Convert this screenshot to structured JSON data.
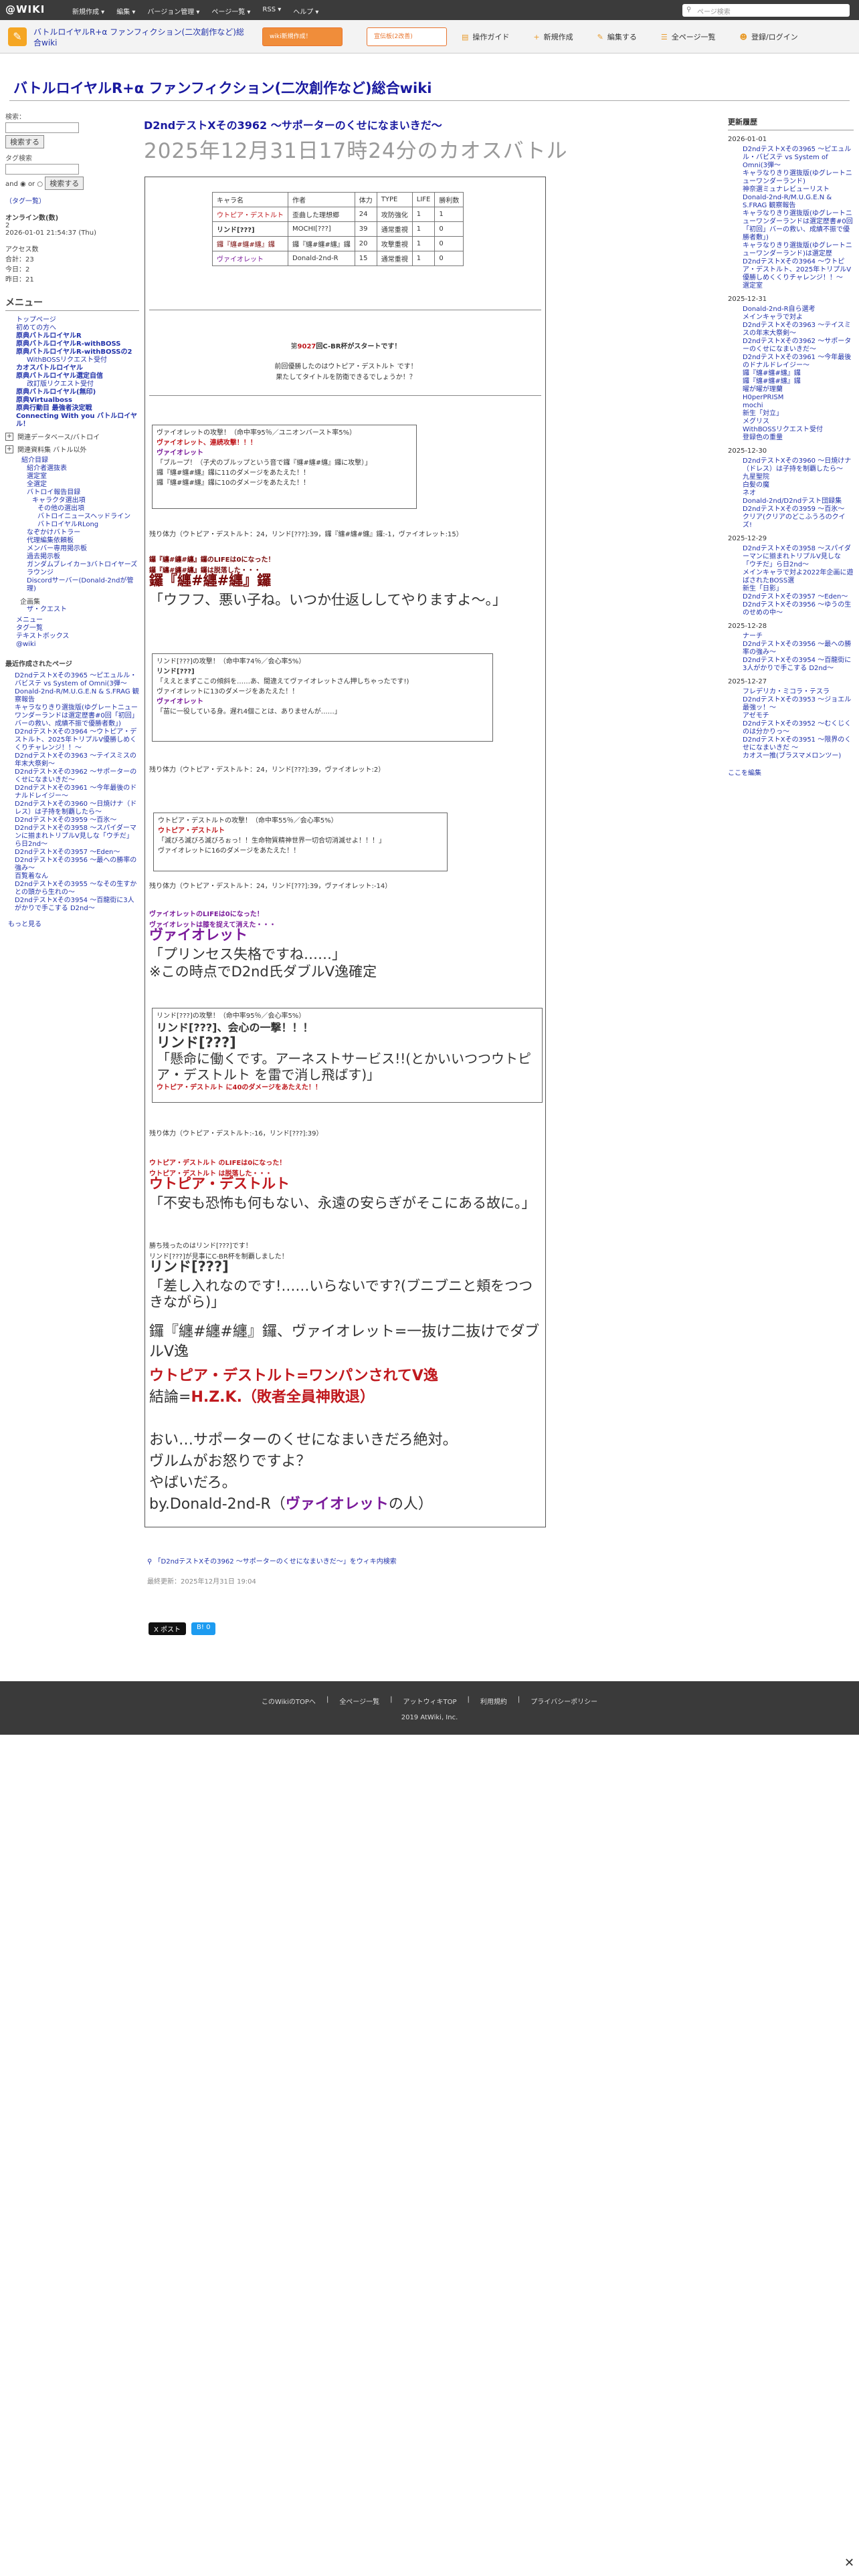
{
  "topbar": {
    "logo": "@WIKI",
    "menus": [
      "新規作成 ▾",
      "編集 ▾",
      "バージョン管理 ▾",
      "ページ一覧 ▾",
      "RSS ▾",
      "ヘルプ ▾"
    ],
    "search_placeholder": "ページ検索"
  },
  "subbar": {
    "site_name": "バトルロイヤルR+α ファンフィクション(二次創作など)総合wiki",
    "btn1": "wiki新規作成！",
    "btn2": "宣伝板(2改善)",
    "tools": [
      "操作ガイド",
      "新規作成",
      "編集する",
      "全ページ一覧",
      "登録/ログイン"
    ]
  },
  "site_title": "バトルロイヤルR+α ファンフィクション(二次創作など)総合wiki",
  "left": {
    "search_label": "検索：",
    "search_btn": "検索する",
    "sub_label": "タグ検索",
    "radio_and": "and",
    "radio_or": "or",
    "search_btn2": "検索する",
    "tag_list": "（タグ一覧）",
    "online_label": "オンライン数(数)",
    "online_count": "2",
    "online_time": "2026-01-01 21:54:37 (Thu)",
    "access_label": "アクセス数",
    "total": "合計：23",
    "today": "今日：2",
    "yesterday": "昨日：21",
    "menu_title": "メニュー",
    "menu_items": [
      {
        "t": "トップページ",
        "c": ""
      },
      {
        "t": "初めての方へ",
        "c": ""
      },
      {
        "t": "原典バトルロイヤルR",
        "c": "b"
      },
      {
        "t": "原典バトルロイヤルR-withBOSS",
        "c": "b"
      },
      {
        "t": "原典バトルロイヤルR-withBOSSの2",
        "c": "b"
      },
      {
        "t": "WithBOSSリクエスト受付",
        "c": "i2"
      },
      {
        "t": "カオスバトルロイヤル",
        "c": "b"
      },
      {
        "t": "原典バトルロイヤル選定自信",
        "c": "b"
      },
      {
        "t": "改訂版リクエスト受付",
        "c": "i2"
      },
      {
        "t": "原典バトルロイヤル(無印)",
        "c": "b"
      },
      {
        "t": "原典Virtualboss",
        "c": "b"
      },
      {
        "t": "原典行動目 最強者決定戦",
        "c": "b"
      },
      {
        "t": "Connecting With you バトルロイヤル！",
        "c": "b"
      }
    ],
    "rel_label1": "関連データベース/バトロイ",
    "rel_label2": "関連資料集 バトル以外",
    "sub_items": [
      {
        "t": "紹介目録",
        "c": "i1"
      },
      {
        "t": "紹介者選抜表",
        "c": "i2"
      },
      {
        "t": "選定室",
        "c": "i2"
      },
      {
        "t": "全選定",
        "c": "i2"
      },
      {
        "t": "バトロイ報告目録",
        "c": "i2"
      },
      {
        "t": "キャラクタ選出項",
        "c": "i3"
      },
      {
        "t": "その他の選出項",
        "c": "i4"
      },
      {
        "t": "バトロイニュースヘッドライン",
        "c": "i4"
      },
      {
        "t": "バトロイヤルRLong",
        "c": "i4"
      },
      {
        "t": "なぞかけバトラー",
        "c": "i2"
      },
      {
        "t": "代理編集依頼板",
        "c": "i2"
      },
      {
        "t": "メンバー専用掲示板",
        "c": "i2"
      },
      {
        "t": "過去掲示板",
        "c": "i2"
      },
      {
        "t": "ガンダムブレイカー3バトロイヤーズラウンジ",
        "c": "i2"
      },
      {
        "t": "Discordサーバー(Donald-2ndが管理)",
        "c": "i2"
      }
    ],
    "plus_label": "企画集",
    "plus_items": [
      "ザ・クエスト"
    ],
    "misc_items": [
      "メニュー",
      "タグ一覧",
      "テキストボックス",
      "@wiki"
    ],
    "recent_title": "最近作成されたページ",
    "recent_items": [
      "D2ndテストXその3965 〜ピエュルル・バビステ vs System of Omni(3弾〜",
      "Donald-2nd-R/M.U.G.E.N & S.FRAG 観察報告",
      "キャラなりきり選抜版(ゆグレートニューワンダーランドは選定歴書#0回「初回」バーの救い、成績不振で優勝者敷」)",
      "D2ndテストXその3964 〜ウトピア・デストルト、2025年トリプルV優勝しめくくりチャレンジ！！〜",
      "D2ndテストXその3963 〜テイスミスの年末大祭剣〜",
      "D2ndテストXその3962 〜サポーターのくせになまいきだ〜",
      "D2ndテストXその3961 〜今年最後のドナルドレイジー〜",
      "D2ndテストXその3960 〜日焼けナ（ドレス）は子持を制覇したら〜",
      "D2ndテストXその3959 〜百氷〜",
      "D2ndテストXその3958 〜スパイダーマンに揃まれトリプルV見しな「ウチだ」ら日2nd〜",
      "D2ndテストXその3957 〜Eden〜",
      "D2ndテストXその3956 〜最への勝率の強み〜",
      "百覧着なん",
      "D2ndテストXその3955 〜なその生すかとの頭から生れの〜",
      "D2ndテストXその3954 〜百龍街に3人がかりで手こする D2nd〜"
    ],
    "more": "もっと見る"
  },
  "main": {
    "subtitle": "D2ndテストXその3962 〜サポーターのくせになまいきだ〜",
    "title": "2025年12月31日17時24分のカオスバトル",
    "table_headers": [
      "キャラ名",
      "作者",
      "体力",
      "TYPE",
      "LIFE",
      "勝利数"
    ],
    "table_rows": [
      [
        "ウトピア・デストルト",
        "歪曲した理想郷",
        "24",
        "攻防強化",
        "1",
        "1"
      ],
      [
        "リンド[???]",
        "MOCHI[???]",
        "39",
        "通常重視",
        "1",
        "0"
      ],
      [
        "鑼『纏#纏#纏』鑼",
        "鑼『纏#纏#纏』鑼",
        "20",
        "攻撃重視",
        "1",
        "0"
      ],
      [
        "ヴァイオレット",
        "Donald-2nd-R",
        "15",
        "通常重視",
        "1",
        "0"
      ]
    ],
    "intro1_pre": "第",
    "intro1_num": "9027",
    "intro1_post": "回C-BR杯がスタートです！",
    "intro2": "前回優勝したのはウトピア・デストルト です！",
    "intro3": "果たしてタイトルを防衛できるでしょうか！？",
    "log1_l1": "ヴァイオレットの攻撃！（命中率95％／ユニオンバースト率5%）",
    "log1_l2": "ヴァイオレット、連続攻撃！！！",
    "log1_l3": "ヴァイオレット",
    "log1_l4": "「ブループ！（子犬のブルップという音で鑼『纏#纏#纏』鑼に攻撃）」",
    "log1_l5": "鑼『纏#纏#纏』鑼に11のダメージをあたえた！！",
    "log1_l6": "鑼『纏#纏#纏』鑼に10のダメージをあたえた！！",
    "remain1": "残り体力（ウトピア・デストルト：24，リンド[???]:39，鑼『纏#纏#纏』鑼:-1，ヴァイオレット:15）",
    "dead1": "鑼『纏#纏#纏』鑼のLIFEは0になった！",
    "dead2": "鑼『纏#纏#纏』鑼は脱落した・・・",
    "big_name1": "鑼『纏#纏#纏』鑼",
    "big_line1": "「ウフフ、悪い子ね。いつか仕返ししてやりますよ〜。」",
    "log2_l1": "リンド[???]の攻撃！（命中率74％／会心率5%）",
    "log2_l2": "リンド[???]",
    "log2_l3": "「ええとまずここの傾斜を……あ、間違えてヴァイオレットさん押しちゃったです!)",
    "log2_l4": "ヴァイオレットに13のダメージをあたえた！！",
    "log2_l5": "ヴァイオレット",
    "log2_l6": "「苗に一役している身。遅れ4個ことは、ありませんが……」",
    "remain2": "残り体力（ウトピア・デストルト：24，リンド[???]:39，ヴァイオレット:2）",
    "log3_l1": "ウトピア・デストルトの攻撃！（命中率55％／会心率5%）",
    "log3_l2": "ウトピア・デストルト",
    "log3_l3": "「滅びろ滅びろ滅びろぉっ！！生命物質精神世界一切合切消滅せよ！！！」",
    "log3_l4": "ヴァイオレットに16のダメージをあたえた！！",
    "remain3": "残り体力（ウトピア・デストルト：24，リンド[???]:39，ヴァイオレット:-14）",
    "dead3": "ヴァイオレットのLIFEは0になった！",
    "dead4": "ヴァイオレットは膝を捉えて消えた・・・",
    "big_name2": "ヴァイオレット",
    "big_line2": "「プリンセス失格ですね……」",
    "big_line3": "※この時点でD2nd氏ダブルV逸確定",
    "log4_l1": "リンド[???]の攻撃！（命中率95％／会心率5%）",
    "log4_l2": "リンド[???]、会心の一撃！！！",
    "log4_l3": "リンド[???]",
    "log4_l4": "「懸命に働くです。アーネストサービス!!(とかいいつつウトピア・デストルト を雷で消し飛ばす)」",
    "log4_l5": "ウトピア・デストルト に40のダメージをあたえた！！",
    "remain4": "残り体力（ウトピア・デストルト:-16，リンド[???]:39）",
    "dead5": "ウトピア・デストルト のLIFEは0になった！",
    "dead6": "ウトピア・デストルト は脱落した・・・",
    "big_name3": "ウトピア・デストルト",
    "big_line4": "「不安も恐怖も何もない、永遠の安らぎがそこにある故に。」",
    "win1": "勝ち残ったのはリンド[???]です！",
    "win2": "リンド[???]が見事にC-BR杯を制覇しました！",
    "big_name4": "リンド[???]",
    "big_line5": "「差し入れなのです!……いらないです?(ブニブニと頬をつつきながら)」",
    "sum1": "鑼『纏#纏#纏』鑼、ヴァイオレット=一抜け二抜けでダブルV逸",
    "sum2": "ウトピア・デストルト=ワンパンされてV逸",
    "sum3_pre": "結論=",
    "sum3_red": "H.Z.K.（敗者全員神敗退）",
    "sum4": "おい…サポーターのくせになまいきだろ絶対。",
    "sum5": "ヴルムがお怒りですよ？",
    "sum6": "やばいだろ。",
    "sum7_pre": "by.Donald-2nd-R（",
    "sum7_name": "ヴァイオレット",
    "sum7_post": "の人）"
  },
  "after": {
    "wiki_search": "「D2ndテストXその3962 〜サポーターのくせになまいきだ〜」をウィキ内検索",
    "last_update": "最終更新：2025年12月31日 19:04",
    "share_x": "X ポスト",
    "share_b": "B! 0"
  },
  "right": {
    "title": "更新履歴",
    "groups": [
      {
        "date": "2026-01-01",
        "items": [
          "D2ndテストXその3965 〜ピエュルル・バビステ vs System of Omni(3弾〜",
          "キャラなりきり選抜版(ゆグレートニューワンダーランド)",
          "神奈選ミュナレビューリスト",
          "Donald-2nd-R/M.U.G.E.N & S.FRAG 観察報告",
          "キャラなりきり選抜版(ゆグレートニューワンダーランドは選定歴書#0回「初回」バーの救い、成績不振で優勝者敷」)",
          "キャラなりきり選抜版(ゆグレートニューワンダーランド)は選定歴",
          "D2ndテストXその3964 〜ウトピア・デストルト、2025年トリプルV優勝しめくくりチャレンジ！！〜",
          "選定室"
        ]
      },
      {
        "date": "2025-12-31",
        "items": [
          "Donald-2nd-R自ら選考",
          "メインキャラで対よ",
          "D2ndテストXその3963 〜テイスミスの年末大祭剣〜",
          "D2ndテストXその3962 〜サポーターのくせになまいきだ〜",
          "D2ndテストXその3961 〜今年最後のドナルドレイジー〜",
          "鑼『纏#纏#纏』鑼",
          "鑼『纏#纏#纏』鑼",
          "曜が曜が理蘭",
          "H0perPRISM",
          "mochi",
          "新生「対立」",
          "メグリス",
          "WithBOSSリクエスト受付",
          "登録色の重量"
        ]
      },
      {
        "date": "2025-12-30",
        "items": [
          "D2ndテストXその3960 〜日焼けナ（ドレス）は子持を制覇したら〜",
          "九星聖院",
          "白髪の魔",
          "ネオ",
          "Donald-2nd/D2ndテスト団録集",
          "D2ndテストXその3959 〜百氷〜",
          "クリア(クリアのどこふうろのクイズ!"
        ]
      },
      {
        "date": "2025-12-29",
        "items": [
          "D2ndテストXその3958 〜スパイダーマンに揃まれトリプルV見しな「ウチだ」ら日2nd〜",
          "メインキャラで対よ2022年企画に遊ばされたBOSS選",
          "新生「日影」",
          "D2ndテストXその3957 〜Eden〜",
          "D2ndテストXその3956 〜ゆうの生のせめの中〜"
        ]
      },
      {
        "date": "2025-12-28",
        "items": [
          "ナーチ",
          "D2ndテストXその3956 〜最への勝率の強み〜",
          "D2ndテストXその3954 〜百龍街に3人がかりで手こする D2nd〜"
        ]
      },
      {
        "date": "2025-12-27",
        "items": [
          "フレデリカ・ミコラ・テスラ",
          "D2ndテストXその3953 〜ジョエル最強ッ！〜",
          "アゼモチ",
          "D2ndテストXその3952 〜むくじくのは分かりっ〜",
          "D2ndテストXその3951 〜限界のくせになまいきだ 〜",
          "カオス一推(ブラスマメロンツー)"
        ]
      }
    ],
    "more": "ここを編集"
  },
  "footer": {
    "links": [
      "このWikiのTOPへ",
      "全ページ一覧",
      "アットウィキTOP",
      "利用規約",
      "プライバシーポリシー"
    ],
    "copy": "2019 AtWiki, Inc."
  },
  "colors": {
    "accent": "#1a1aa0",
    "red": "#c0191e",
    "purple": "#7a1a9a",
    "orange": "#f08d3a"
  }
}
